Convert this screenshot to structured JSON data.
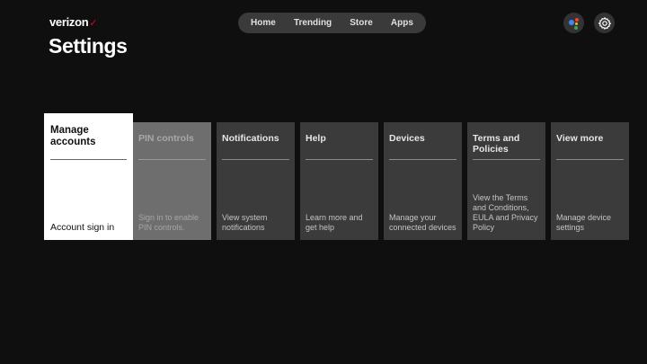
{
  "header": {
    "brand": "verizon",
    "brand_mark": "✓",
    "page_title": "Settings"
  },
  "nav": {
    "items": [
      "Home",
      "Trending",
      "Store",
      "Apps"
    ]
  },
  "icons": {
    "assistant": "google-assistant-icon",
    "settings": "gear-icon"
  },
  "colors": {
    "brand_accent": "#e4002b",
    "assistant_blue": "#4285f4",
    "assistant_red": "#ea4335",
    "assistant_yellow": "#fbbc05",
    "assistant_green": "#34a853"
  },
  "tiles": [
    {
      "title": "Manage accounts",
      "desc": "Account sign in",
      "state": "focused"
    },
    {
      "title": "PIN controls",
      "desc": "Sign in to enable PIN controls.",
      "state": "disabled"
    },
    {
      "title": "Notifications",
      "desc": "View system notifications",
      "state": "normal"
    },
    {
      "title": "Help",
      "desc": "Learn more and get help",
      "state": "normal"
    },
    {
      "title": "Devices",
      "desc": "Manage your connected devices",
      "state": "normal"
    },
    {
      "title": "Terms and Policies",
      "desc": "View the Terms and Conditions, EULA and Privacy Policy",
      "state": "normal"
    },
    {
      "title": "View more",
      "desc": "Manage device settings",
      "state": "normal"
    }
  ]
}
